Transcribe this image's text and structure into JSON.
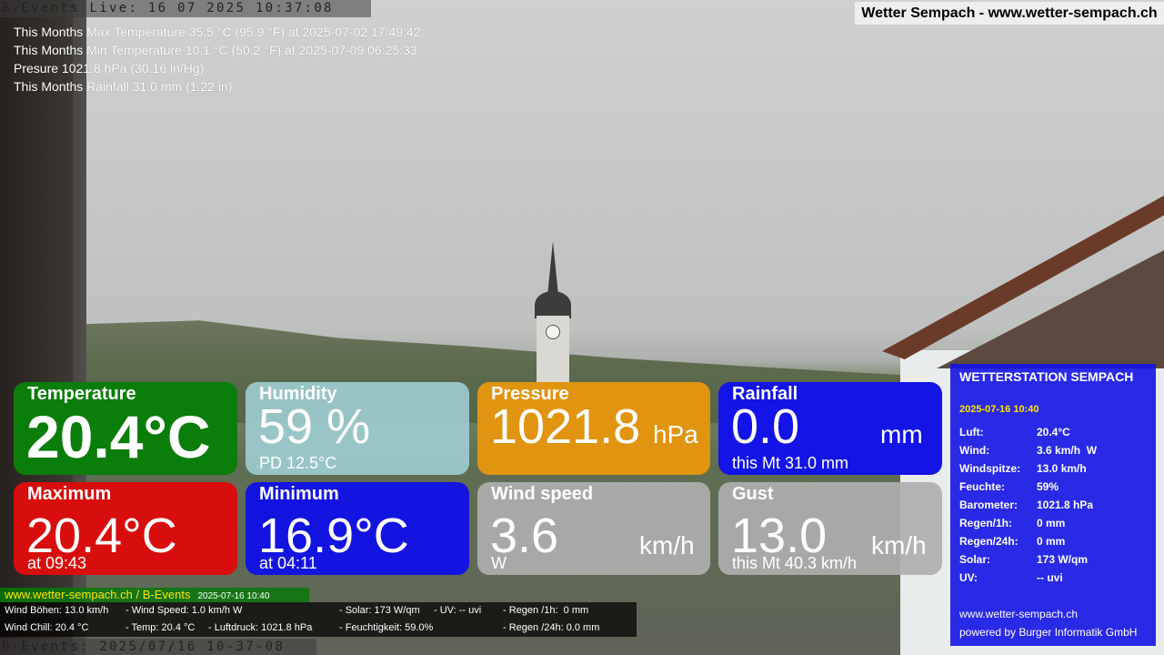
{
  "ticker": {
    "top": "B-Events Live: 16 07 2025 10:37:08",
    "bottom": "B-Events: 2025/07/16 10-37-08"
  },
  "site_badge": "Wetter Sempach - www.wetter-sempach.ch",
  "month_stats": {
    "max": "This Months Max Temperature 35.5 °C (95.9 °F) at 2025-07-02 17:49:42",
    "min": "This Months Min Temperature 10.1 °C (50.2 °F) at 2025-07-09 06:25:33",
    "pressure": "Presure 1021.8 hPa (30.16 in/Hg)",
    "rainfall": "This Months Rainfall 31.0 mm (1.22 in)"
  },
  "tiles": {
    "temperature": {
      "label": "Temperature",
      "value": "20.4°C",
      "color": "#0a7d0a"
    },
    "humidity": {
      "label": "Humidity",
      "value": "59 %",
      "sub": "PD 12.5°C"
    },
    "pressure": {
      "label": "Pressure",
      "value": "1021.8",
      "unit": "hPa",
      "color": "#e09410"
    },
    "rainfall": {
      "label": "Rainfall",
      "value": "0.0",
      "unit": "mm",
      "sub": "this Mt 31.0 mm"
    },
    "maximum": {
      "label": "Maximum",
      "value": "20.4°C",
      "sub": "at 09:43",
      "color": "#d80d0d"
    },
    "minimum": {
      "label": "Minimum",
      "value": "16.9°C",
      "sub": "at 04:11"
    },
    "wind": {
      "label": "Wind speed",
      "value": "3.6",
      "unit": "km/h",
      "sub": "W"
    },
    "gust": {
      "label": "Gust",
      "value": "13.0",
      "unit": "km/h",
      "sub": "this Mt 40.3 km/h"
    }
  },
  "station": {
    "title": "WETTERSTATION SEMPACH",
    "date": "2025-07-16 10:40",
    "rows": [
      {
        "k": "Luft:",
        "v": "20.4°C"
      },
      {
        "k": "Wind:",
        "v": "3.6 km/h  W"
      },
      {
        "k": "Windspitze:",
        "v": "13.0 km/h"
      },
      {
        "k": "Feuchte:",
        "v": "59%"
      },
      {
        "k": "Barometer:",
        "v": "1021.8 hPa"
      },
      {
        "k": "Regen/1h:",
        "v": "0 mm"
      },
      {
        "k": "Regen/24h:",
        "v": "0 mm"
      },
      {
        "k": "Solar:",
        "v": "173 W/qm"
      },
      {
        "k": "UV:",
        "v": "-- uvi"
      }
    ],
    "footer_url": "www.wetter-sempach.ch",
    "footer_credit": "powered by Burger Informatik GmbH"
  },
  "bottom_bar": {
    "title": "www.wetter-sempach.ch / B-Events",
    "date": "2025-07-16 10:40",
    "wind_gusts": "Wind Böhen: 13.0 km/h",
    "wind_speed": "- Wind Speed: 1.0 km/h W",
    "solar": "- Solar: 173 W/qm",
    "uv": "- UV: -- uvi",
    "rain_1h": "- Regen /1h:  0 mm",
    "wind_chill": "Wind Chill: 20.4 °C",
    "temp": "- Temp: 20.4 °C",
    "pressure": "- Luftdruck: 1021.8 hPa",
    "humidity": "- Feuchtigkeit: 59.0%",
    "rain_24h": "- Regen /24h: 0.0 mm"
  }
}
